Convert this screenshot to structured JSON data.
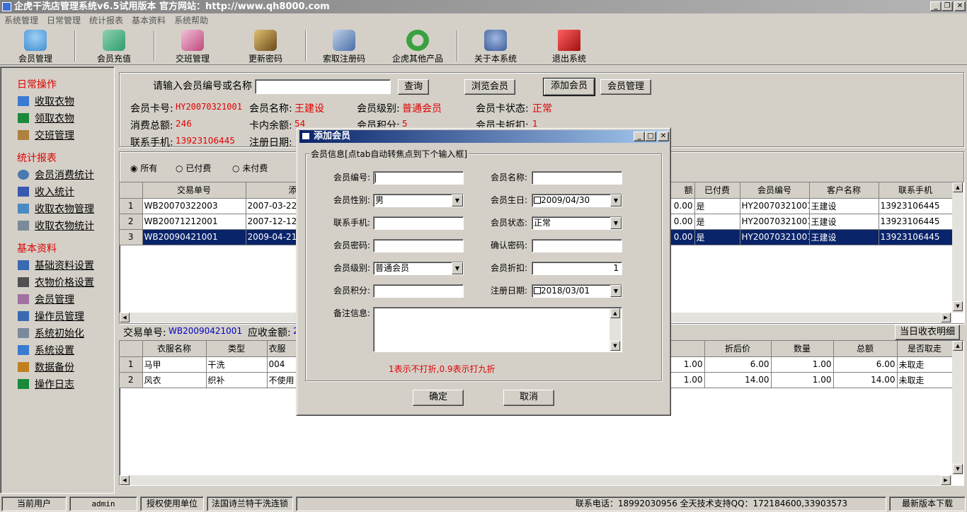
{
  "window": {
    "title": "企虎干洗店管理系统v6.5试用版本 官方网站：http://www.qh8000.com"
  },
  "menu": [
    "系统管理",
    "日常管理",
    "统计报表",
    "基本资料",
    "系统帮助"
  ],
  "toolbar": [
    {
      "label": "会员管理",
      "icon": "member-icon",
      "color": "#3f8fd0"
    },
    {
      "label": "会员充值",
      "icon": "recharge-icon",
      "color": "#2e9e6e"
    },
    {
      "label": "交班管理",
      "icon": "shift-icon",
      "color": "#c0487a"
    },
    {
      "label": "更新密码",
      "icon": "key-icon",
      "color": "#8a6a2a"
    },
    {
      "label": "索取注册码",
      "icon": "register-icon",
      "color": "#4a6fa8"
    },
    {
      "label": "企虎其他产品",
      "icon": "refresh-icon",
      "color": "#3aa040"
    },
    {
      "label": "关于本系统",
      "icon": "about-icon",
      "color": "#3a5a9a"
    },
    {
      "label": "退出系统",
      "icon": "exit-icon",
      "color": "#d02020"
    }
  ],
  "sidebar": {
    "sections": [
      {
        "title": "日常操作",
        "items": [
          {
            "label": "收取衣物",
            "icon": "receive-clothes-icon",
            "color": "#3a7ad0"
          },
          {
            "label": "领取衣物",
            "icon": "pickup-clothes-icon",
            "color": "#1a8a3a"
          },
          {
            "label": "交班管理",
            "icon": "shift-box-icon",
            "color": "#b08040"
          }
        ]
      },
      {
        "title": "统计报表",
        "items": [
          {
            "label": "会员消费统计",
            "icon": "search-icon",
            "color": "#4a7ab0"
          },
          {
            "label": "收入统计",
            "icon": "income-icon",
            "color": "#3a5ab0"
          },
          {
            "label": "收取衣物管理",
            "icon": "clothes-manage-icon",
            "color": "#4a8ac0"
          },
          {
            "label": "收取衣物统计",
            "icon": "printer-icon",
            "color": "#7a8a9a"
          }
        ]
      },
      {
        "title": "基本资料",
        "items": [
          {
            "label": "基础资料设置",
            "icon": "settings-pen-icon",
            "color": "#3a6ab0"
          },
          {
            "label": "衣物价格设置",
            "icon": "price-icon",
            "color": "#505050"
          },
          {
            "label": "会员管理",
            "icon": "member-card-icon",
            "color": "#a070a0"
          },
          {
            "label": "操作员管理",
            "icon": "operator-icon",
            "color": "#3a6ab0"
          },
          {
            "label": "系统初始化",
            "icon": "init-icon",
            "color": "#7a8a9a"
          },
          {
            "label": "系统设置",
            "icon": "system-settings-icon",
            "color": "#3a7ad0"
          },
          {
            "label": "数据备份",
            "icon": "wrench-icon",
            "color": "#c08020"
          },
          {
            "label": "操作日志",
            "icon": "log-icon",
            "color": "#1a8a3a"
          }
        ]
      }
    ]
  },
  "search": {
    "prompt": "请输入会员编号或名称",
    "value": "",
    "query_btn": "查询",
    "browse_btn": "浏览会员",
    "add_btn": "添加会员",
    "manage_btn": "会员管理"
  },
  "member": {
    "card_label": "会员卡号:",
    "card": "HY20070321001",
    "name_label": "会员名称:",
    "name": "王建设",
    "level_label": "会员级别:",
    "level": "普通会员",
    "status_label": "会员卡状态:",
    "status": "正常",
    "total_label": "消费总额:",
    "total": "246",
    "balance_label": "卡内余额:",
    "balance": "54",
    "points_label": "会员积分:",
    "points": "5",
    "discount_label": "会员卡折扣:",
    "discount": "1",
    "phone_label": "联系手机:",
    "phone": "13923106445",
    "regdate_label": "注册日期:"
  },
  "filter": {
    "options": [
      "所有",
      "已付费",
      "未付费"
    ],
    "selected": 0
  },
  "orders": {
    "headers_left": [
      "交易单号",
      "添"
    ],
    "headers_right": [
      "额",
      "已付费",
      "会员编号",
      "客户名称",
      "联系手机"
    ],
    "rows": [
      {
        "no": "1",
        "id": "WB20070322003",
        "date": "2007-03-22 10",
        "amt": "0.00",
        "paid": "是",
        "mid": "HY20070321001",
        "cust": "王建设",
        "phone": "13923106445"
      },
      {
        "no": "2",
        "id": "WB20071212001",
        "date": "2007-12-12 14",
        "amt": "0.00",
        "paid": "是",
        "mid": "HY20070321001",
        "cust": "王建设",
        "phone": "13923106445"
      },
      {
        "no": "3",
        "id": "WB20090421001",
        "date": "2009-04-21 11",
        "amt": "0.00",
        "paid": "是",
        "mid": "HY20070321001",
        "cust": "王建设",
        "phone": "13923106445"
      }
    ]
  },
  "detail": {
    "trade_label": "交易单号:",
    "trade_no": "WB20090421001",
    "due_label": "应收金额:",
    "due_partial": "2",
    "today_btn": "当日收衣明细",
    "headers_left": [
      "衣服名称",
      "类型",
      "衣服"
    ],
    "headers_right": [
      "扣",
      "折后价",
      "数量",
      "总额",
      "是否取走"
    ],
    "rows": [
      {
        "no": "1",
        "name": "马甲",
        "type": "干洗",
        "code": "004",
        "disc": "1.00",
        "after": "6.00",
        "qty": "1.00",
        "total": "6.00",
        "taken": "未取走"
      },
      {
        "no": "2",
        "name": "风衣",
        "type": "织补",
        "code": "不使用",
        "disc": "1.00",
        "after": "14.00",
        "qty": "1.00",
        "total": "14.00",
        "taken": "未取走"
      }
    ]
  },
  "dialog": {
    "title": "添加会员",
    "group": "会员信息[点tab自动转焦点到下个输入框]",
    "fields": {
      "id_label": "会员编号:",
      "id": "",
      "name_label": "会员名称:",
      "name": "",
      "gender_label": "会员性别:",
      "gender": "男",
      "birth_label": "会员生日:",
      "birth": "2009/04/30",
      "phone_label": "联系手机:",
      "phone": "",
      "status_label": "会员状态:",
      "status": "正常",
      "pwd_label": "会员密码:",
      "pwd": "",
      "pwd2_label": "确认密码:",
      "pwd2": "",
      "level_label": "会员级别:",
      "level": "普通会员",
      "discount_label": "会员折扣:",
      "discount": "1",
      "points_label": "会员积分:",
      "points": "",
      "regdate_label": "注册日期:",
      "regdate": "2018/03/01",
      "remark_label": "备注信息:",
      "remark": ""
    },
    "hint": "1表示不打折,0.9表示打九折",
    "ok": "确定",
    "cancel": "取消"
  },
  "statusbar": {
    "user_label": "当前用户",
    "user": "admin",
    "licensee_label": "授权使用单位",
    "licensee": "法国诗兰特干洗连锁",
    "contact": "联系电话：18992030956  全天技术支持QQ：172184600,33903573",
    "download": "最新版本下载"
  }
}
